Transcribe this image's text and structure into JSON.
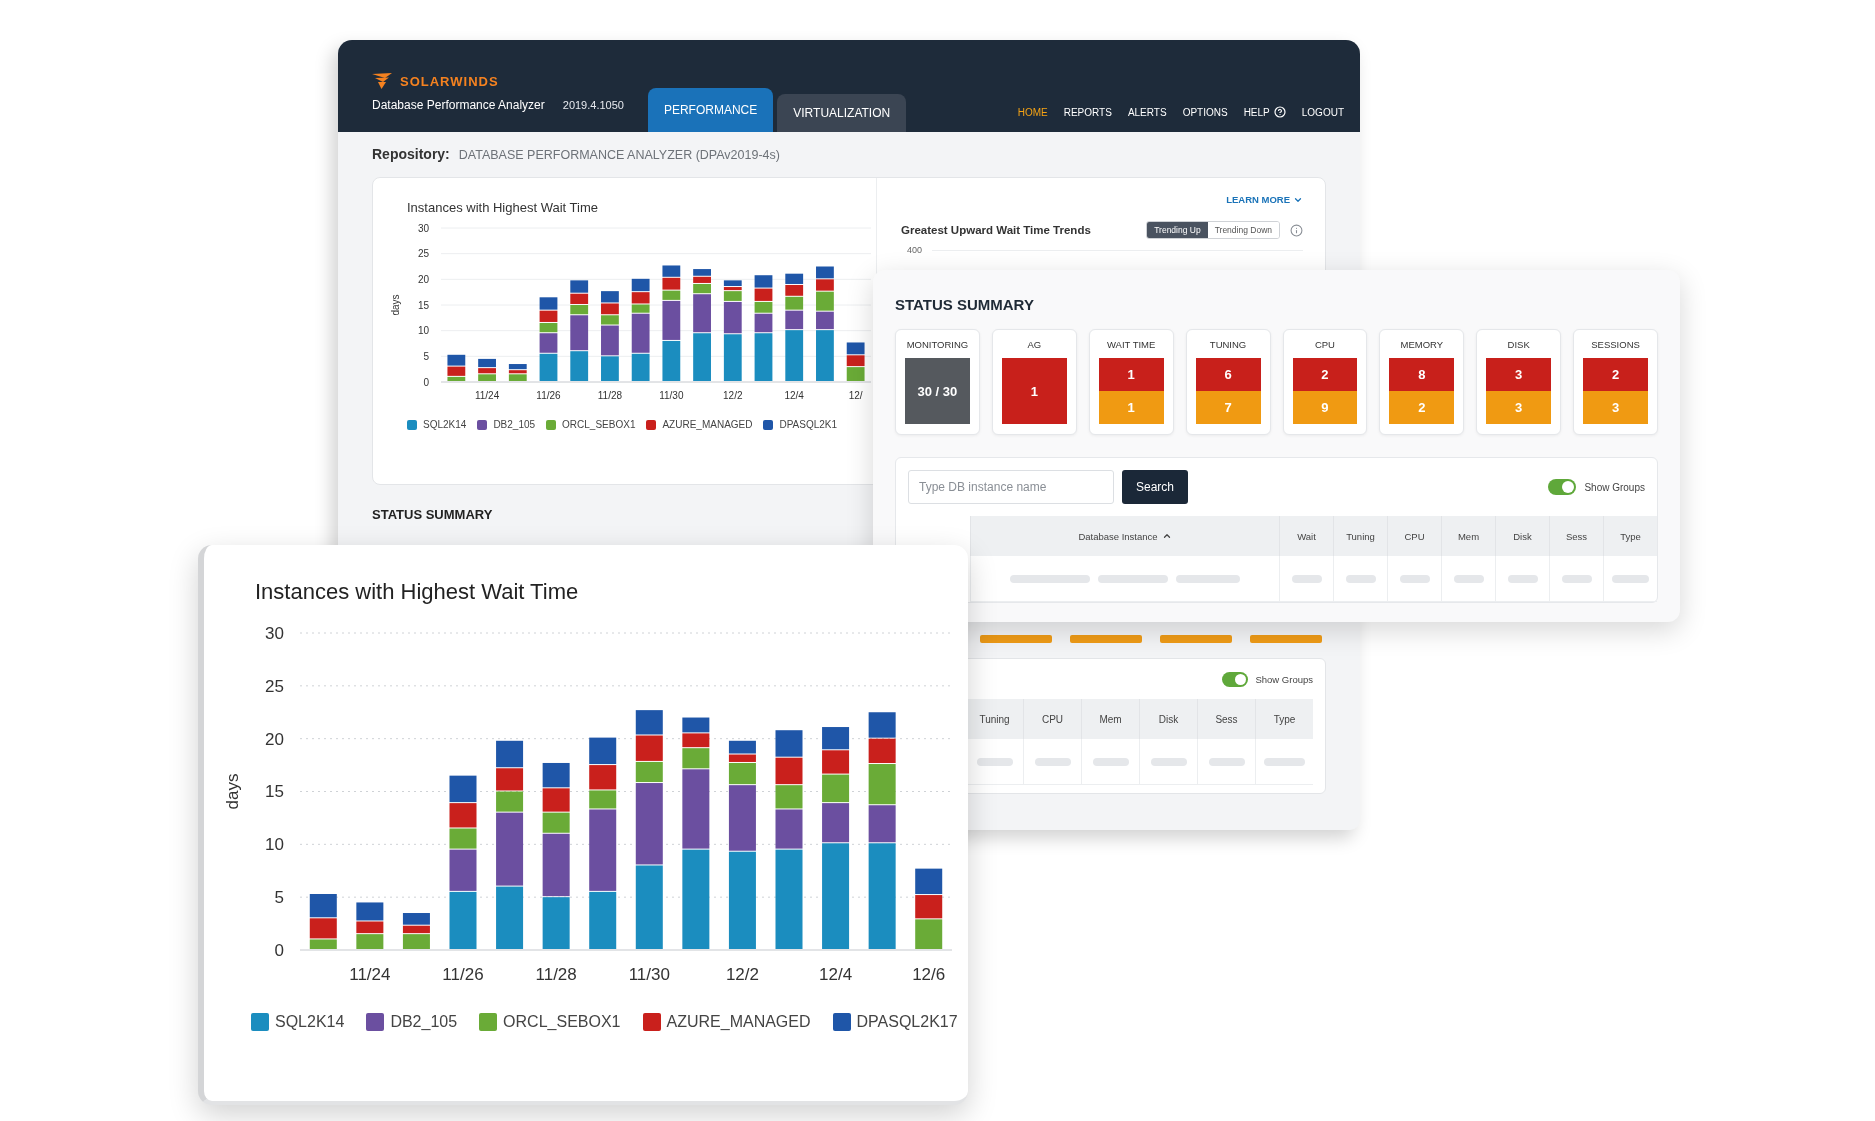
{
  "dashboard_window": {
    "header": {
      "brand": "SOLARWINDS",
      "product": "Database Performance Analyzer",
      "version": "2019.4.1050",
      "tabs": [
        {
          "label": "PERFORMANCE",
          "selected": true
        },
        {
          "label": "VIRTUALIZATION",
          "selected": false
        }
      ],
      "nav": [
        {
          "label": "HOME",
          "kind": "link",
          "selected": true
        },
        {
          "label": "REPORTS",
          "kind": "link",
          "selected": false
        },
        {
          "label": "ALERTS",
          "kind": "link",
          "selected": false
        },
        {
          "label": "OPTIONS",
          "kind": "link",
          "selected": false
        },
        {
          "label": "HELP",
          "kind": "help",
          "selected": false
        },
        {
          "label": "LOGOUT",
          "kind": "link",
          "selected": false
        }
      ]
    },
    "repository": {
      "label": "Repository:",
      "value": "DATABASE PERFORMANCE ANALYZER (DPAv2019-4s)"
    },
    "overview": {
      "learn_more": "LEARN MORE",
      "wait_time_chart": {
        "chart_data": {
          "type": "bar",
          "title": "Instances with Highest Wait Time",
          "ylabel": "days",
          "stacked": true,
          "grid": true,
          "categories": [
            null,
            "11/24",
            null,
            "11/26",
            null,
            "11/28",
            null,
            "11/30",
            null,
            "12/2",
            null,
            "12/4",
            null,
            "12/"
          ],
          "ylim": [
            0,
            30
          ],
          "yticks": [
            0,
            5,
            10,
            15,
            20,
            25,
            30
          ],
          "series": [
            {
              "name": "SQL2K14",
              "color": "#1b8dbf",
              "values": [
                0,
                0,
                0,
                5.5,
                6,
                5,
                5.5,
                8,
                9.5,
                9.3,
                9.5,
                10.1,
                10.1,
                0
              ]
            },
            {
              "name": "DB2_105",
              "color": "#6b4fa0",
              "values": [
                0,
                0,
                0,
                4,
                7,
                6,
                7.8,
                7.8,
                7.6,
                6.3,
                3.8,
                3.8,
                3.6,
                0
              ]
            },
            {
              "name": "ORCL_SEBOX1",
              "color": "#6aab37",
              "values": [
                1,
                1.5,
                1.5,
                2,
                2,
                2,
                1.8,
                2,
                2,
                2.1,
                2.3,
                2.7,
                3.9,
                2.9
              ]
            },
            {
              "name": "AZURE_MANAGED",
              "color": "#c9201c",
              "values": [
                2,
                1.2,
                0.8,
                2.4,
                2.2,
                2.3,
                2.4,
                2.5,
                1.4,
                0.8,
                2.6,
                2.3,
                2.4,
                2.3
              ]
            },
            {
              "name": "DPASQL2K1",
              "color": "#1f56a8",
              "values": [
                2.3,
                1.8,
                1.2,
                2.6,
                2.6,
                2.4,
                2.6,
                2.4,
                1.5,
                1.3,
                2.6,
                2.2,
                2.5,
                2.5
              ]
            }
          ]
        }
      },
      "trends": {
        "title": "Greatest Upward Wait Time Trends",
        "top_tick": "400",
        "modes": [
          {
            "label": "Trending Up",
            "selected": true
          },
          {
            "label": "Trending Down",
            "selected": false
          }
        ]
      }
    },
    "status_summary": {
      "title": "STATUS SUMMARY",
      "tiles": [
        {
          "warning": true
        },
        {
          "warning": true
        },
        {
          "warning": true
        },
        {
          "warning": true
        }
      ],
      "show_groups": {
        "label": "Show Groups",
        "on": true
      },
      "columns": [
        "Tuning",
        "CPU",
        "Mem",
        "Disk",
        "Sess",
        "Type"
      ]
    }
  },
  "status_card": {
    "title": "STATUS SUMMARY",
    "tiles": [
      {
        "label": "MONITORING",
        "kind": "total",
        "value": "30 / 30"
      },
      {
        "label": "AG",
        "kind": "alert",
        "critical": "1"
      },
      {
        "label": "WAIT TIME",
        "kind": "alert",
        "critical": "1",
        "warning": "1"
      },
      {
        "label": "TUNING",
        "kind": "alert",
        "critical": "6",
        "warning": "7"
      },
      {
        "label": "CPU",
        "kind": "alert",
        "critical": "2",
        "warning": "9"
      },
      {
        "label": "MEMORY",
        "kind": "alert",
        "critical": "8",
        "warning": "2"
      },
      {
        "label": "DISK",
        "kind": "alert",
        "critical": "3",
        "warning": "3"
      },
      {
        "label": "SESSIONS",
        "kind": "alert",
        "critical": "2",
        "warning": "3"
      }
    ],
    "search": {
      "placeholder": "Type DB instance name",
      "button": "Search"
    },
    "show_groups": {
      "label": "Show Groups",
      "on": true
    },
    "columns": [
      {
        "label": "Database Instance",
        "sorted": true
      },
      {
        "label": "Wait",
        "sorted": false
      },
      {
        "label": "Tuning",
        "sorted": false
      },
      {
        "label": "CPU",
        "sorted": false
      },
      {
        "label": "Mem",
        "sorted": false
      },
      {
        "label": "Disk",
        "sorted": false
      },
      {
        "label": "Sess",
        "sorted": false
      },
      {
        "label": "Type",
        "sorted": false
      }
    ]
  },
  "wait_time_card": {
    "chart_data": {
      "type": "bar",
      "title": "Instances with Highest Wait Time",
      "ylabel": "days",
      "stacked": true,
      "grid": true,
      "categories": [
        null,
        "11/24",
        null,
        "11/26",
        null,
        "11/28",
        null,
        "11/30",
        null,
        "12/2",
        null,
        "12/4",
        null,
        "12/6"
      ],
      "ylim": [
        0,
        30
      ],
      "yticks": [
        0,
        5,
        10,
        15,
        20,
        25,
        30
      ],
      "series": [
        {
          "name": "SQL2K14",
          "color": "#1b8dbf",
          "values": [
            0,
            0,
            0,
            5.5,
            6,
            5,
            5.5,
            8,
            9.5,
            9.3,
            9.5,
            10.1,
            10.1,
            0
          ]
        },
        {
          "name": "DB2_105",
          "color": "#6b4fa0",
          "values": [
            0,
            0,
            0,
            4,
            7,
            6,
            7.8,
            7.8,
            7.6,
            6.3,
            3.8,
            3.8,
            3.6,
            0
          ]
        },
        {
          "name": "ORCL_SEBOX1",
          "color": "#6aab37",
          "values": [
            1,
            1.5,
            1.5,
            2,
            2,
            2,
            1.8,
            2,
            2,
            2.1,
            2.3,
            2.7,
            3.9,
            2.9
          ]
        },
        {
          "name": "AZURE_MANAGED",
          "color": "#c9201c",
          "values": [
            2,
            1.2,
            0.8,
            2.4,
            2.2,
            2.3,
            2.4,
            2.5,
            1.4,
            0.8,
            2.6,
            2.3,
            2.4,
            2.3
          ]
        },
        {
          "name": "DPASQL2K17",
          "color": "#1f56a8",
          "values": [
            2.3,
            1.8,
            1.2,
            2.6,
            2.6,
            2.4,
            2.6,
            2.4,
            1.5,
            1.3,
            2.6,
            2.2,
            2.5,
            2.5
          ]
        }
      ]
    }
  }
}
